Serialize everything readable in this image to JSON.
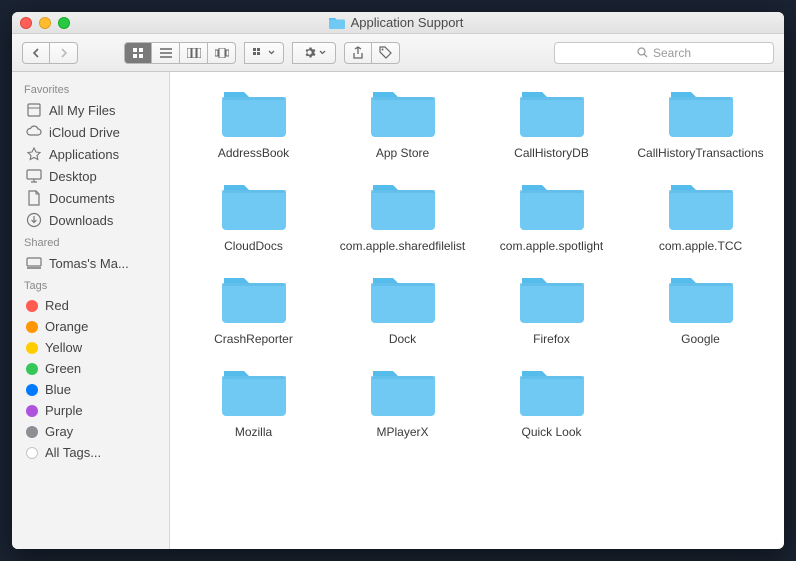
{
  "window": {
    "title": "Application Support"
  },
  "search": {
    "placeholder": "Search"
  },
  "sidebar": {
    "sections": [
      {
        "header": "Favorites",
        "items": [
          {
            "label": "All My Files",
            "icon": "all-my-files-icon"
          },
          {
            "label": "iCloud Drive",
            "icon": "cloud-icon"
          },
          {
            "label": "Applications",
            "icon": "applications-icon"
          },
          {
            "label": "Desktop",
            "icon": "desktop-icon"
          },
          {
            "label": "Documents",
            "icon": "documents-icon"
          },
          {
            "label": "Downloads",
            "icon": "downloads-icon"
          }
        ]
      },
      {
        "header": "Shared",
        "items": [
          {
            "label": "Tomas's Ma...",
            "icon": "computer-icon"
          }
        ]
      },
      {
        "header": "Tags",
        "items": [
          {
            "label": "Red",
            "color": "#ff5b51"
          },
          {
            "label": "Orange",
            "color": "#ff9500"
          },
          {
            "label": "Yellow",
            "color": "#ffcc00"
          },
          {
            "label": "Green",
            "color": "#34c759"
          },
          {
            "label": "Blue",
            "color": "#007aff"
          },
          {
            "label": "Purple",
            "color": "#af52de"
          },
          {
            "label": "Gray",
            "color": "#8e8e93"
          },
          {
            "label": "All Tags...",
            "color": "#d6d6d6"
          }
        ]
      }
    ]
  },
  "folders": [
    {
      "name": "AddressBook"
    },
    {
      "name": "App Store"
    },
    {
      "name": "CallHistoryDB"
    },
    {
      "name": "CallHistoryTransactions"
    },
    {
      "name": "CloudDocs"
    },
    {
      "name": "com.apple.sharedfilelist"
    },
    {
      "name": "com.apple.spotlight"
    },
    {
      "name": "com.apple.TCC"
    },
    {
      "name": "CrashReporter"
    },
    {
      "name": "Dock"
    },
    {
      "name": "Firefox"
    },
    {
      "name": "Google"
    },
    {
      "name": "Mozilla"
    },
    {
      "name": "MPlayerX"
    },
    {
      "name": "Quick Look"
    }
  ],
  "colors": {
    "folder": "#6fc9f2",
    "folderTab": "#56bceb"
  }
}
